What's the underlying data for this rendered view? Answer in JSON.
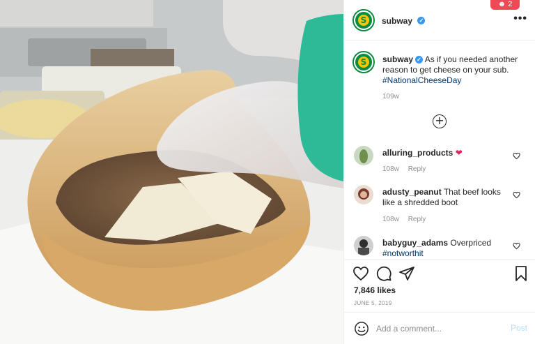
{
  "notification": {
    "icon": "person-icon",
    "count": "2"
  },
  "header": {
    "username": "subway",
    "verified_badge": "✓",
    "more_options": "•••"
  },
  "caption": {
    "username": "subway",
    "text": "As if you needed another reason to get cheese on your sub.",
    "hashtag": "#NationalCheeseDay",
    "timestamp": "109w"
  },
  "load_more_icon": "plus-circle-icon",
  "comments": [
    {
      "username": "alluring_products",
      "text": "",
      "emoji": "❤",
      "age": "108w",
      "reply": "Reply"
    },
    {
      "username": "adusty_peanut",
      "text": "That beef looks like a shredded boot",
      "age": "108w",
      "reply": "Reply"
    },
    {
      "username": "babyguy_adams",
      "text": "Overpriced",
      "hashtag": "#notworthit"
    }
  ],
  "actions": {
    "like_icon": "heart-icon",
    "comment_icon": "comment-icon",
    "share_icon": "send-icon",
    "save_icon": "bookmark-icon",
    "likes": "7,846 likes",
    "date": "JUNE 5, 2019"
  },
  "comment_box": {
    "emoji_icon": "smiley-icon",
    "placeholder": "Add a comment...",
    "post_label": "Post"
  },
  "colors": {
    "brand_green": "#0b8a42",
    "brand_yellow": "#f7c600",
    "verified_blue": "#3897f0",
    "hashtag_blue": "#00376b",
    "post_disabled": "#b2dffc",
    "notification_red": "#ed4956"
  }
}
